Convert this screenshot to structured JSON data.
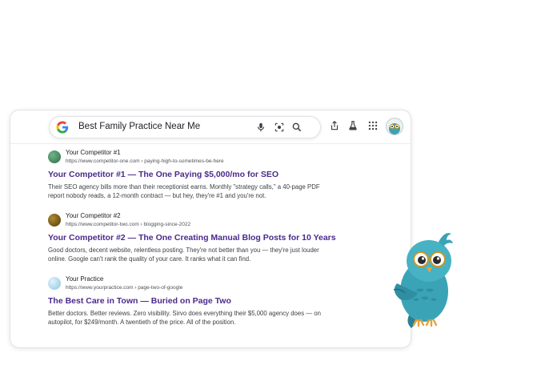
{
  "search": {
    "query": "Best Family Practice Near Me",
    "icons": [
      "google-logo",
      "mic-icon",
      "lens-icon",
      "search-icon"
    ]
  },
  "toolbar": {
    "icons": [
      "share-icon",
      "labs-flask-icon",
      "apps-grid-icon",
      "avatar"
    ]
  },
  "results": [
    {
      "site_name": "Your Competitor #1",
      "url": "https://www.competitor-one.com › paying-high-to-sometimes-be-here",
      "title": "Your Competitor #1 — The One Paying $5,000/mo for SEO",
      "snippet": "Their SEO agency bills more than their receptionist earns. Monthly \"strategy calls,\" a 40-page PDF report nobody reads, a 12-month contract — but hey, they're #1 and you're not.",
      "favicon_color": "#3f8a5e"
    },
    {
      "site_name": "Your Competitor #2",
      "url": "https://www.competitor-two.com › blogging-since-2022",
      "title": "Your Competitor #2 — The One Creating Manual Blog Posts for 10 Years",
      "snippet": "Good doctors, decent website, relentless posting. They're not better than you — they're just louder online. Google can't rank the quality of your care. It ranks what it can find.",
      "favicon_color": "#7a5a14"
    },
    {
      "site_name": "Your Practice",
      "url": "https://www.yourpractice.com › page-two-of-google",
      "title": "The Best Care in Town — Buried on Page Two",
      "snippet": "Better doctors. Better reviews. Zero visibility. Sirvo does everything their $5,000 agency does — on autopilot, for $249/month. A twentieth of the price. All of the position.",
      "favicon_color": "#a9d6ec"
    }
  ],
  "colors": {
    "result_title": "#4b2a8c",
    "owl_body": "#3aa3b6"
  }
}
